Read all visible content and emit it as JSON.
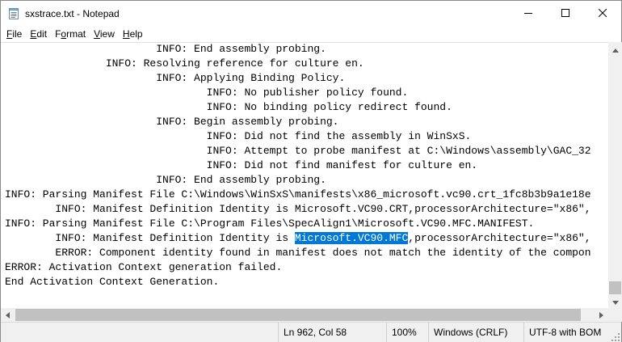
{
  "window": {
    "title": "sxstrace.txt - Notepad"
  },
  "icons": {
    "app": "notepad-icon",
    "minimize": "minimize-icon",
    "maximize": "maximize-icon",
    "close": "close-icon"
  },
  "menu": [
    {
      "key": "F",
      "rest": "ile"
    },
    {
      "key": "E",
      "rest": "dit"
    },
    {
      "pre": "F",
      "key": "o",
      "rest": "rmat"
    },
    {
      "key": "V",
      "rest": "iew"
    },
    {
      "key": "H",
      "rest": "elp"
    }
  ],
  "editor": {
    "lines": [
      "                        INFO: End assembly probing.",
      "                INFO: Resolving reference for culture en.",
      "                        INFO: Applying Binding Policy.",
      "                                INFO: No publisher policy found.",
      "                                INFO: No binding policy redirect found.",
      "                        INFO: Begin assembly probing.",
      "                                INFO: Did not find the assembly in WinSxS.",
      "                                INFO: Attempt to probe manifest at C:\\Windows\\assembly\\GAC_32",
      "                                INFO: Did not find manifest for culture en.",
      "                        INFO: End assembly probing.",
      "INFO: Parsing Manifest File C:\\Windows\\WinSxS\\manifests\\x86_microsoft.vc90.crt_1fc8b3b9a1e18e",
      "        INFO: Manifest Definition Identity is Microsoft.VC90.CRT,processorArchitecture=\"x86\",",
      "INFO: Parsing Manifest File C:\\Program Files\\SpecAlign1\\Microsoft.VC90.MFC.MANIFEST.",
      "SELECTED_LINE",
      "        ERROR: Component identity found in manifest does not match the identity of the compon",
      "ERROR: Activation Context generation failed.",
      "End Activation Context Generation."
    ],
    "selected_line": {
      "before": "        INFO: Manifest Definition Identity is ",
      "selected": "Microsoft.VC90.MFC",
      "after": ",processorArchitecture=\"x86\","
    }
  },
  "statusbar": {
    "position": "Ln 962, Col 58",
    "zoom": "100%",
    "line_ending": "Windows (CRLF)",
    "encoding": "UTF-8 with BOM"
  },
  "colors": {
    "selection": "#0078d7",
    "scroll_track": "#f0f0f0",
    "scroll_thumb": "#c1c1c1"
  }
}
